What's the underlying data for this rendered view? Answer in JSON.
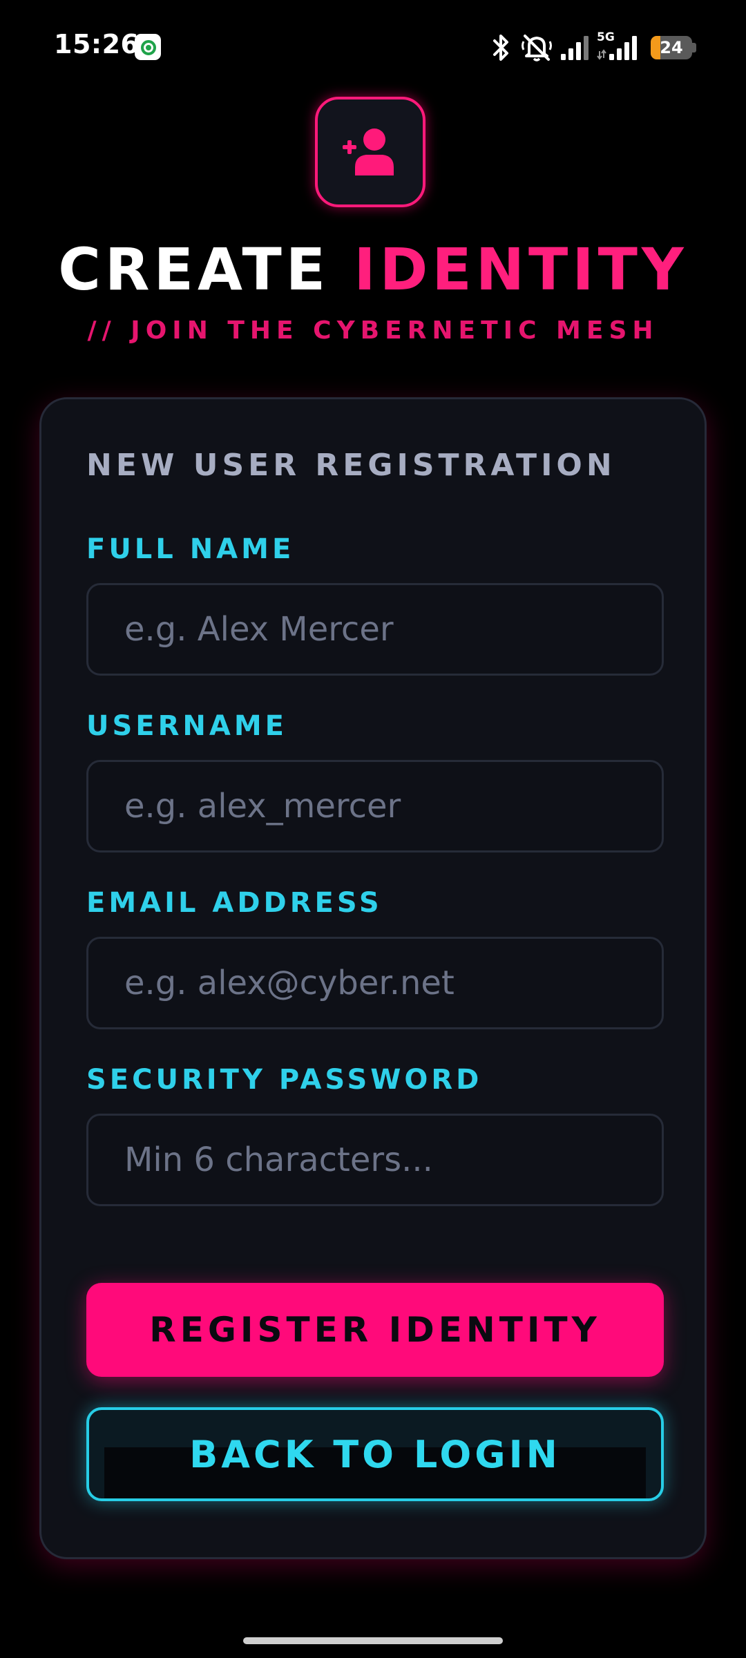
{
  "status_bar": {
    "time": "15:26",
    "app_icon": "app-notification-icon",
    "network": "5G",
    "battery": "24",
    "battery_level": 0.24,
    "icons": [
      "bluetooth-icon",
      "mute-icon",
      "signal-icon",
      "signal-5g-icon",
      "battery-icon"
    ]
  },
  "header": {
    "logo_icon": "add-user-icon",
    "title_part1": "CREATE",
    "title_part2": "IDENTITY",
    "subtitle": "// JOIN THE CYBERNETIC MESH"
  },
  "form": {
    "heading": "NEW USER REGISTRATION",
    "fields": [
      {
        "label": "FULL NAME",
        "placeholder": "e.g. Alex Mercer",
        "value": ""
      },
      {
        "label": "USERNAME",
        "placeholder": "e.g. alex_mercer",
        "value": ""
      },
      {
        "label": "EMAIL ADDRESS",
        "placeholder": "e.g. alex@cyber.net",
        "value": ""
      },
      {
        "label": "SECURITY PASSWORD",
        "placeholder": "Min 6 characters...",
        "value": ""
      }
    ],
    "register_label": "REGISTER IDENTITY",
    "back_label": "BACK TO LOGIN"
  },
  "colors": {
    "background": "#000000",
    "accent_pink": "#ff0a7a",
    "accent_cyan": "#2fd0ea",
    "card": "#0f1118",
    "muted_text": "#a7adc2"
  }
}
